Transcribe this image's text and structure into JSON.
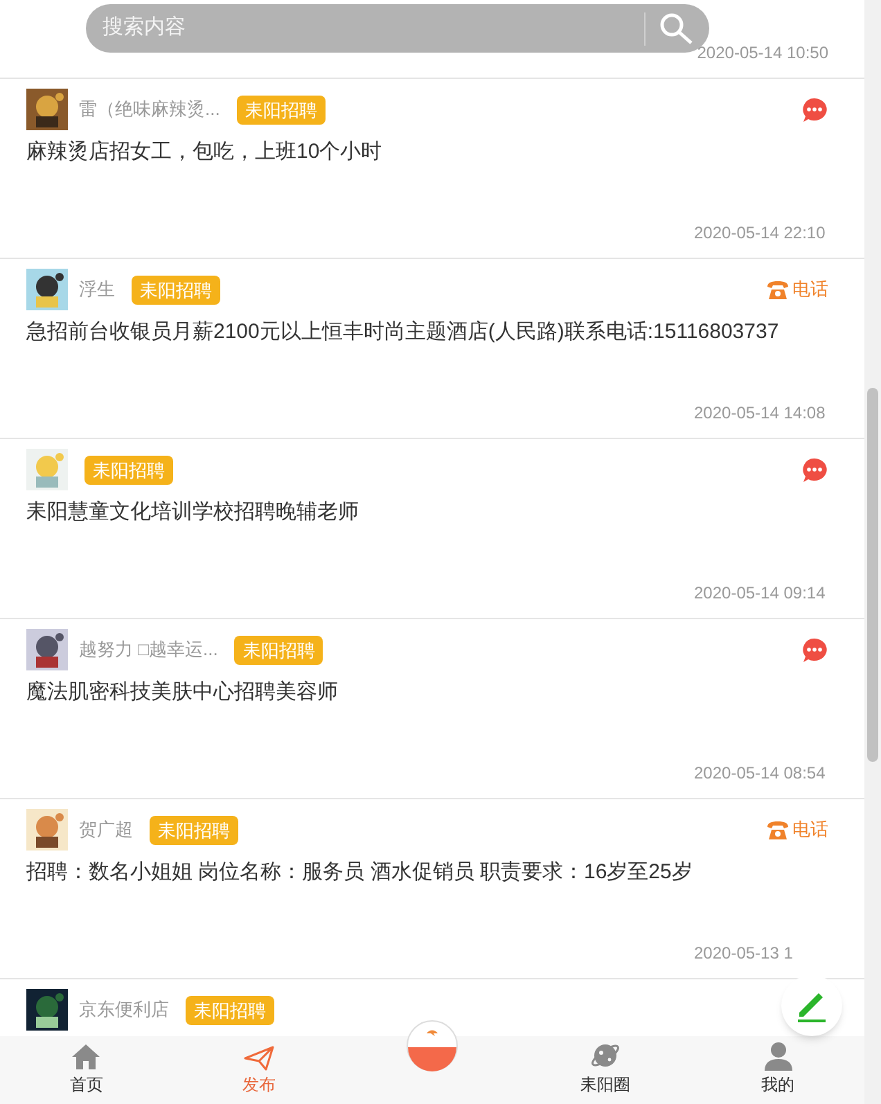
{
  "search": {
    "placeholder": "搜索内容"
  },
  "top_post": {
    "time": "2020-05-14 10:50"
  },
  "posts": [
    {
      "name": "雷（绝味麻辣烫...",
      "tag": "耒阳招聘",
      "action": {
        "kind": "chat"
      },
      "text": "麻辣烫店招女工，包吃，上班10个小时",
      "time": "2020-05-14 22:10"
    },
    {
      "name": "浮生",
      "tag": "耒阳招聘",
      "action": {
        "kind": "phone",
        "label": "电话"
      },
      "text": "急招前台收银员月薪2100元以上恒丰时尚主题酒店(人民路)联系电话:15116803737",
      "time": "2020-05-14 14:08"
    },
    {
      "tag": "耒阳招聘",
      "action": {
        "kind": "chat"
      },
      "text": "耒阳慧童文化培训学校招聘晚辅老师",
      "time": "2020-05-14 09:14"
    },
    {
      "name": "越努力 □越幸运...",
      "tag": "耒阳招聘",
      "action": {
        "kind": "chat"
      },
      "text": "魔法肌密科技美肤中心招聘美容师",
      "time": "2020-05-14 08:54"
    },
    {
      "name": "贺广超",
      "tag": "耒阳招聘",
      "action": {
        "kind": "phone",
        "label": "电话"
      },
      "text": "招聘：数名小姐姐 岗位名称：服务员 酒水促销员 职责要求：16岁至25岁",
      "time": "2020-05-13 1"
    }
  ],
  "last_post": {
    "name": "京东便利店",
    "tag": "耒阳招聘"
  },
  "tabs": [
    {
      "kind": "home",
      "label": "首页",
      "selected": false
    },
    {
      "kind": "send",
      "label": "发布",
      "selected": true
    },
    {
      "kind": "logo",
      "selected": false
    },
    {
      "kind": "planet",
      "label": "耒阳圈",
      "selected": false
    },
    {
      "kind": "user",
      "label": "我的",
      "selected": false
    }
  ]
}
